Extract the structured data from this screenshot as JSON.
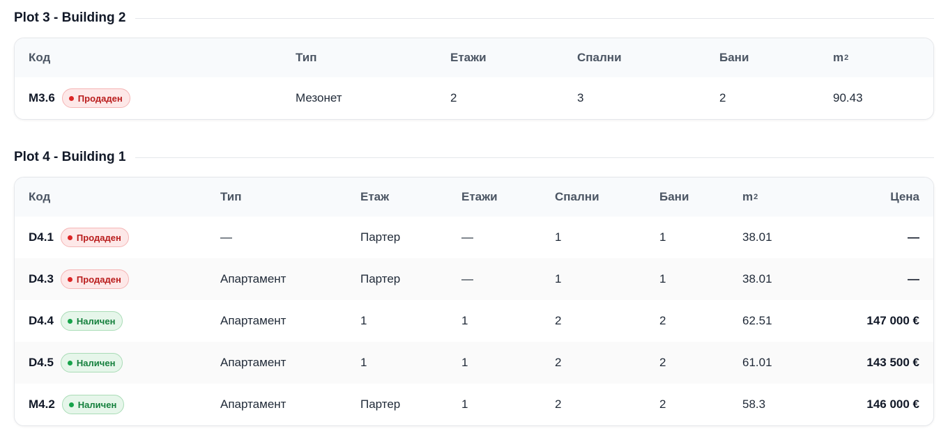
{
  "sections": [
    {
      "title": "Plot 3 - Building 2",
      "headers": {
        "code": "Код",
        "type": "Тип",
        "floors": "Етажи",
        "bedrooms": "Спални",
        "bathrooms": "Бани",
        "area": "m",
        "area_sup": "2"
      },
      "rows": [
        {
          "code": "M3.6",
          "status": "Продаден",
          "type": "Мезонет",
          "floors": "2",
          "bedrooms": "3",
          "bathrooms": "2",
          "area": "90.43"
        }
      ]
    },
    {
      "title": "Plot 4 - Building 1",
      "headers": {
        "code": "Код",
        "type": "Тип",
        "floor": "Етаж",
        "floors": "Етажи",
        "bedrooms": "Спални",
        "bathrooms": "Бани",
        "area": "m",
        "area_sup": "2",
        "price": "Цена"
      },
      "rows": [
        {
          "code": "D4.1",
          "status": "Продаден",
          "type": "—",
          "floor": "Партер",
          "floors": "—",
          "bedrooms": "1",
          "bathrooms": "1",
          "area": "38.01",
          "price": "—"
        },
        {
          "code": "D4.3",
          "status": "Продаден",
          "type": "Апартамент",
          "floor": "Партер",
          "floors": "—",
          "bedrooms": "1",
          "bathrooms": "1",
          "area": "38.01",
          "price": "—"
        },
        {
          "code": "D4.4",
          "status": "Наличен",
          "type": "Апартамент",
          "floor": "1",
          "floors": "1",
          "bedrooms": "2",
          "bathrooms": "2",
          "area": "62.51",
          "price": "147 000 €"
        },
        {
          "code": "D4.5",
          "status": "Наличен",
          "type": "Апартамент",
          "floor": "1",
          "floors": "1",
          "bedrooms": "2",
          "bathrooms": "2",
          "area": "61.01",
          "price": "143 500 €"
        },
        {
          "code": "M4.2",
          "status": "Наличен",
          "type": "Апартамент",
          "floor": "Партер",
          "floors": "1",
          "bedrooms": "2",
          "bathrooms": "2",
          "area": "58.3",
          "price": "146 000 €"
        }
      ]
    }
  ],
  "colors": {
    "sold": "#dc2626",
    "available": "#16a34a"
  }
}
